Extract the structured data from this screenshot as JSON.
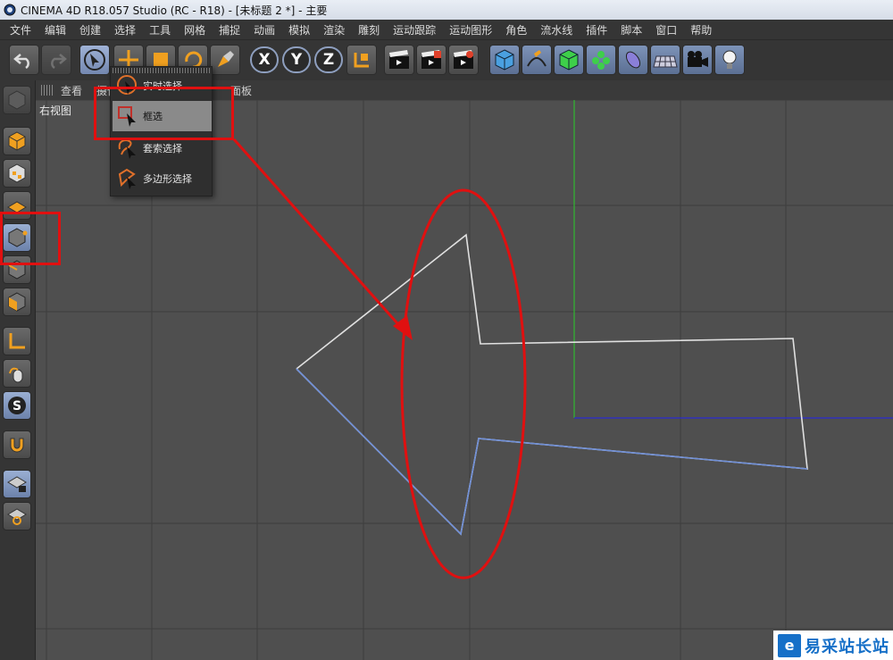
{
  "window": {
    "title": "CINEMA 4D R18.057 Studio (RC - R18) - [未标题 2 *] - 主要"
  },
  "menu": [
    "文件",
    "编辑",
    "创建",
    "选择",
    "工具",
    "网格",
    "捕捉",
    "动画",
    "模拟",
    "渲染",
    "雕刻",
    "运动跟踪",
    "运动图形",
    "角色",
    "流水线",
    "插件",
    "脚本",
    "窗口",
    "帮助"
  ],
  "viewport_menu": [
    "查看",
    "摄像",
    "",
    "",
    "",
    "面板"
  ],
  "viewport": {
    "label": "右视图"
  },
  "selection_menu": {
    "items": [
      {
        "label": "实时选择",
        "icon": "live-selection-icon",
        "active": false
      },
      {
        "label": "框选",
        "icon": "rectangle-selection-icon",
        "active": true
      },
      {
        "label": "套索选择",
        "icon": "lasso-selection-icon",
        "active": false
      },
      {
        "label": "多边形选择",
        "icon": "polygon-selection-icon",
        "active": false
      }
    ]
  },
  "axes": {
    "x": "X",
    "y": "Y",
    "z": "Z"
  },
  "colors": {
    "highlight": "#e01010",
    "y_axis": "#2fb82f",
    "x_axis": "#2a2ad0",
    "spline": "#e0e0e0",
    "spline_selected": "#6f8fd8"
  },
  "watermark": {
    "text": "易采站长站",
    "logo": "e"
  }
}
